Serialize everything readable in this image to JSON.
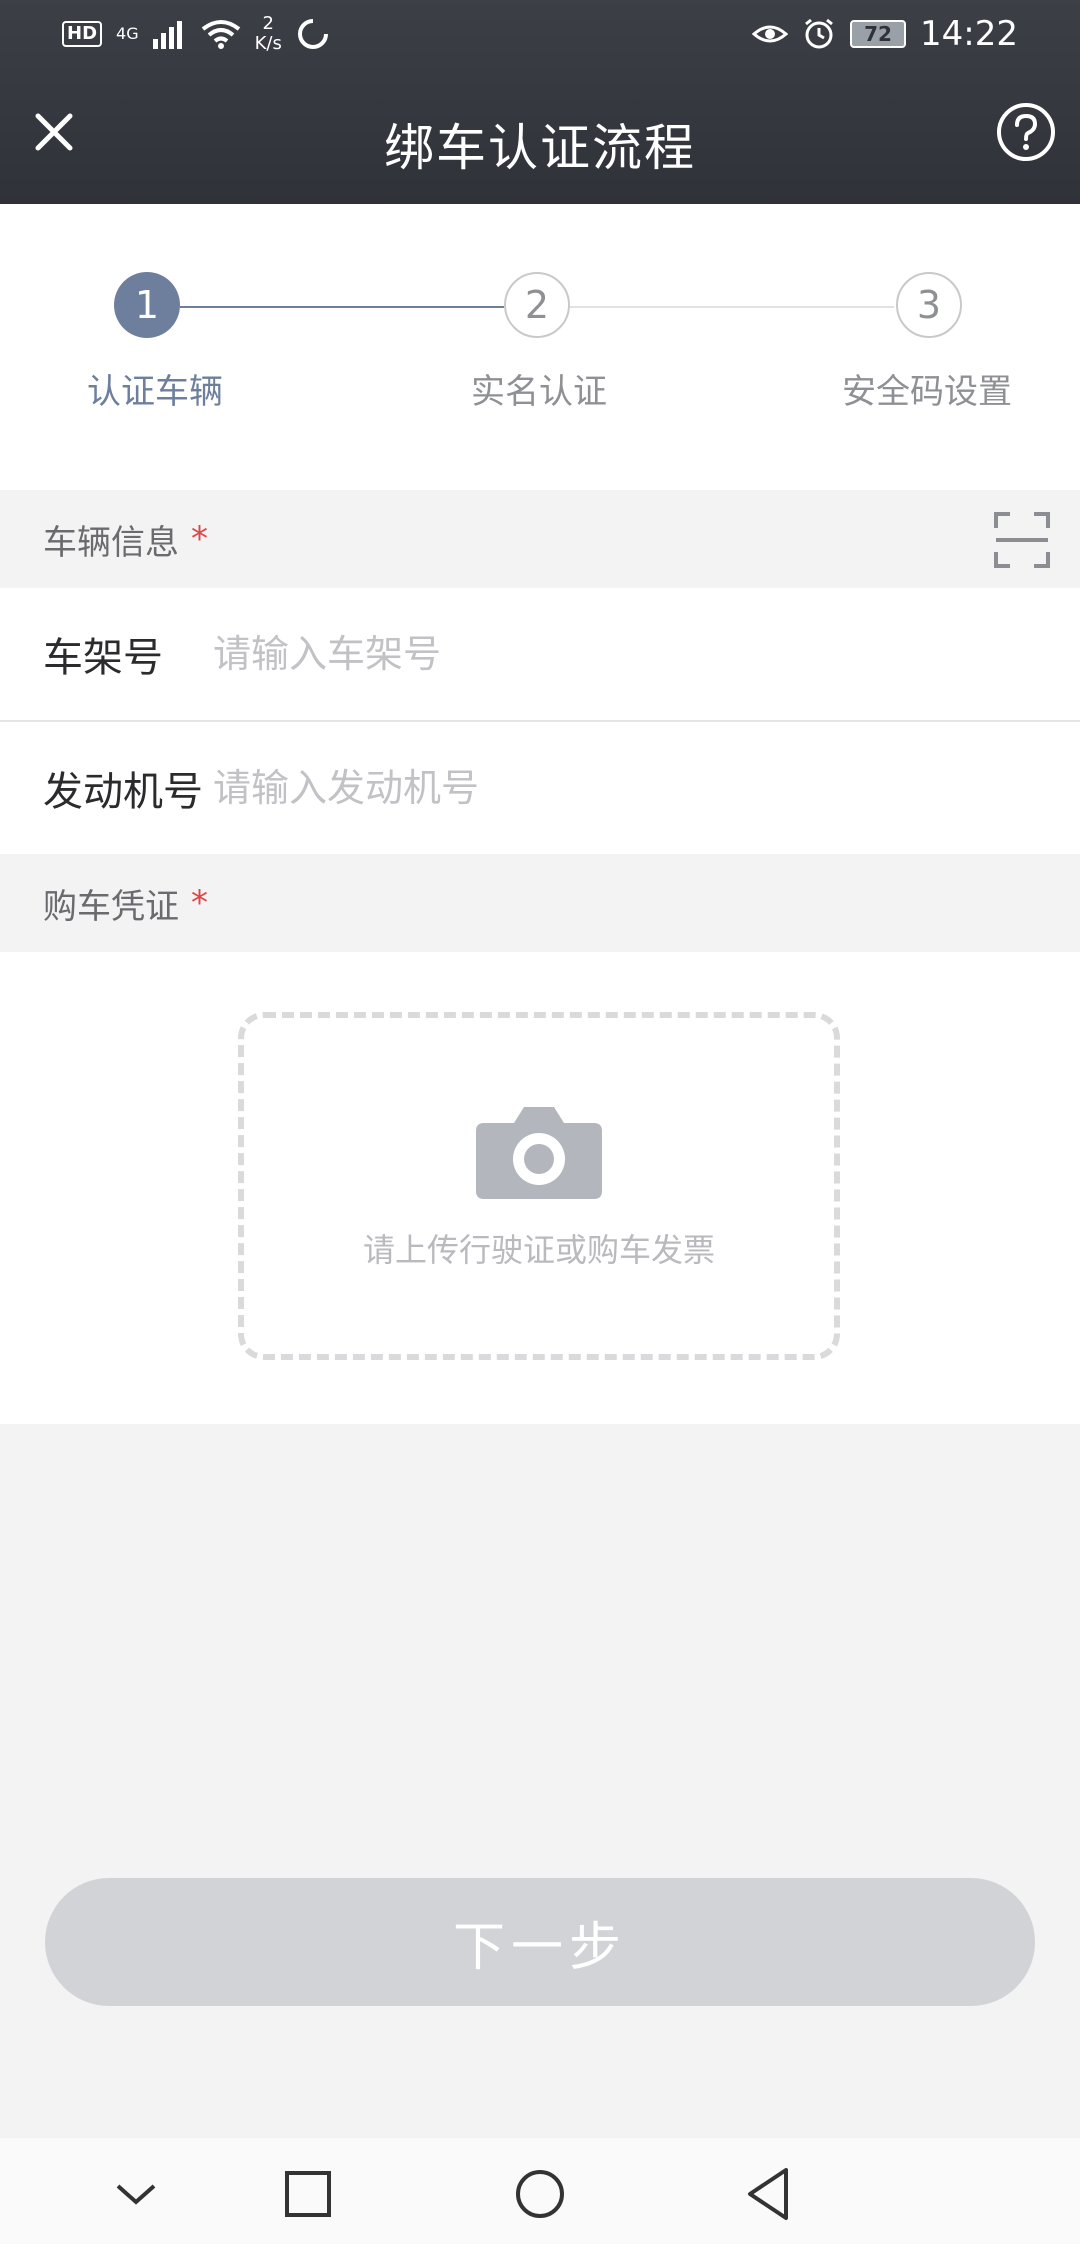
{
  "status_bar": {
    "left_badge": "HD",
    "network": "4G",
    "speed_value": "2",
    "speed_unit": "K/s",
    "battery": "72",
    "time": "14:22"
  },
  "header": {
    "title": "绑车认证流程"
  },
  "steps": [
    {
      "number": "1",
      "label": "认证车辆",
      "active": true
    },
    {
      "number": "2",
      "label": "实名认证",
      "active": false
    },
    {
      "number": "3",
      "label": "安全码设置",
      "active": false
    }
  ],
  "vehicle_section": {
    "title": "车辆信息",
    "required_mark": "*",
    "fields": [
      {
        "label": "车架号",
        "value": "",
        "placeholder": "请输入车架号"
      },
      {
        "label": "发动机号",
        "value": "",
        "placeholder": "请输入发动机号"
      }
    ]
  },
  "proof_section": {
    "title": "购车凭证",
    "required_mark": "*",
    "upload_hint": "请上传行驶证或购车发票"
  },
  "next_button": {
    "label": "下一步"
  },
  "colors": {
    "header_bg": "#2f3238",
    "accent": "#6e7f9e",
    "required": "#e04545",
    "button_disabled": "#d1d3d7"
  },
  "icons": [
    "close-icon",
    "help-icon",
    "scan-icon",
    "camera-icon",
    "nav-down-icon",
    "nav-recent-icon",
    "nav-home-icon",
    "nav-back-icon"
  ]
}
